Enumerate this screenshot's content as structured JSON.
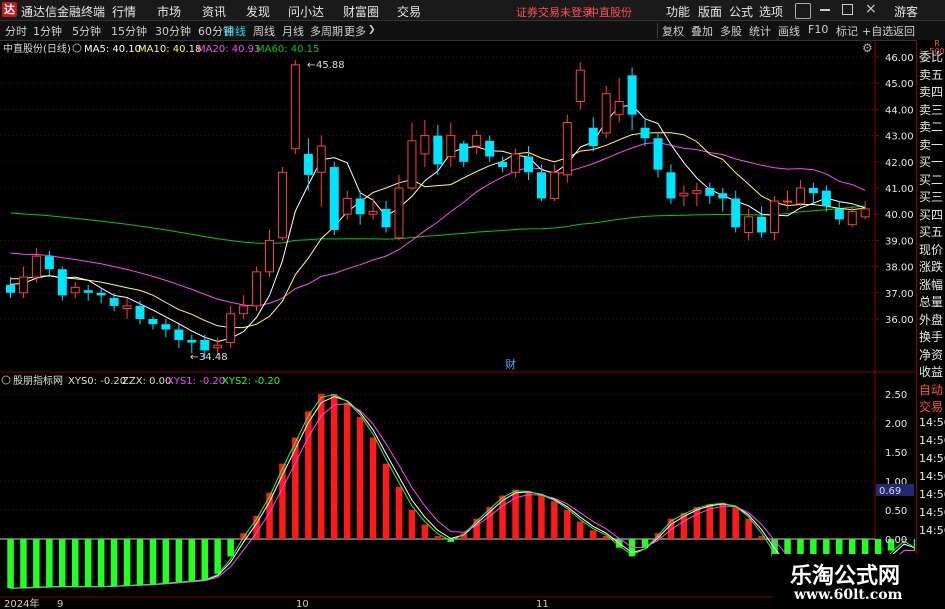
{
  "menu": {
    "app_title": "通达信金融终端",
    "items": [
      "行情",
      "市场",
      "资讯",
      "发现",
      "问小达",
      "财富圈",
      "交易"
    ],
    "status_warning": "证券交易未登录",
    "status_stock": "中直股份",
    "right_items": [
      "功能",
      "版面",
      "公式",
      "选项"
    ],
    "guest": "游客"
  },
  "toolbar": {
    "periods": [
      "分时",
      "1分钟",
      "5分钟",
      "15分钟",
      "30分钟",
      "60分钟",
      "日线",
      "周线",
      "月线",
      "多周期",
      "更多"
    ],
    "selected_period": "日线",
    "right_buttons": [
      "复权",
      "叠加",
      "多股",
      "统计",
      "画线",
      "F10",
      "标记",
      "+自选",
      "返回"
    ]
  },
  "main_legend": {
    "name": "中直股份(日线)",
    "ma5": "MA5: 40.10",
    "ma10": "MA10: 40.18",
    "ma20": "MA20: 40.93",
    "ma60": "MA60: 40.15"
  },
  "annotations": {
    "high_label": "45.88",
    "low_label": "34.48",
    "fin_marker": "财"
  },
  "indicator_legend": {
    "name": "股朋指标网",
    "xys0": "XYS0: -0.20",
    "zzx": "ZZX: 0.00",
    "xys1": "XYS1: -0.20",
    "xys2": "XYS2: -0.20"
  },
  "price_axis": [
    "46.00",
    "45.00",
    "44.00",
    "43.00",
    "42.00",
    "41.00",
    "40.00",
    "39.00",
    "38.00",
    "37.00",
    "36.00"
  ],
  "indicator_axis": [
    "2.50",
    "2.00",
    "1.50",
    "1.00",
    "0.50",
    "0.00"
  ],
  "indicator_current": "0.69",
  "date_axis": [
    "2024年",
    "9",
    "10",
    "11"
  ],
  "right_panel": {
    "top_tag": "R\n500",
    "items": [
      "委比",
      "卖五",
      "卖四",
      "卖三",
      "卖二",
      "卖一",
      "买一",
      "买二",
      "买三",
      "买四",
      "买五",
      "现价",
      "涨跌",
      "涨幅",
      "总量",
      "外盘",
      "换手",
      "净资",
      "收益",
      "自动",
      "交易"
    ],
    "times": [
      "14:56",
      "14:56",
      "14:56",
      "14:56",
      "14:56",
      "14:56",
      "14:56"
    ]
  },
  "watermark": {
    "title": "乐淘公式网",
    "url": "www.60lt.com"
  },
  "colors": {
    "up": "#ff3c3c",
    "down": "#00e5ff",
    "ma5": "#ffffff",
    "ma10": "#ffff66",
    "ma20": "#ff44ff",
    "ma60": "#00cc00",
    "indicator_pos": "#ff1a1a",
    "indicator_neg": "#22ff22",
    "grid": "#8b0000"
  },
  "chart_data": {
    "type": "candlestick",
    "title": "中直股份(日线)",
    "ylim": [
      34.48,
      46.0
    ],
    "candles": [
      {
        "o": 37.3,
        "c": 37.0,
        "h": 37.6,
        "l": 36.8
      },
      {
        "o": 37.0,
        "c": 37.6,
        "h": 38.0,
        "l": 36.8
      },
      {
        "o": 37.6,
        "c": 38.4,
        "h": 38.7,
        "l": 37.4
      },
      {
        "o": 38.4,
        "c": 37.9,
        "h": 38.6,
        "l": 37.6
      },
      {
        "o": 37.9,
        "c": 36.9,
        "h": 38.0,
        "l": 36.7
      },
      {
        "o": 37.0,
        "c": 37.2,
        "h": 37.4,
        "l": 36.8
      },
      {
        "o": 37.1,
        "c": 37.0,
        "h": 37.3,
        "l": 36.7
      },
      {
        "o": 37.0,
        "c": 36.9,
        "h": 37.2,
        "l": 36.6
      },
      {
        "o": 36.8,
        "c": 36.5,
        "h": 37.0,
        "l": 36.3
      },
      {
        "o": 36.4,
        "c": 36.5,
        "h": 36.8,
        "l": 36.0
      },
      {
        "o": 36.5,
        "c": 36.0,
        "h": 36.7,
        "l": 35.8
      },
      {
        "o": 36.0,
        "c": 35.8,
        "h": 36.1,
        "l": 35.6
      },
      {
        "o": 35.8,
        "c": 35.6,
        "h": 36.0,
        "l": 35.3
      },
      {
        "o": 35.6,
        "c": 35.2,
        "h": 35.8,
        "l": 34.9
      },
      {
        "o": 35.2,
        "c": 35.1,
        "h": 35.4,
        "l": 34.7
      },
      {
        "o": 35.2,
        "c": 34.8,
        "h": 35.4,
        "l": 34.48
      },
      {
        "o": 34.9,
        "c": 35.0,
        "h": 35.3,
        "l": 34.6
      },
      {
        "o": 35.1,
        "c": 36.2,
        "h": 36.5,
        "l": 34.9
      },
      {
        "o": 36.2,
        "c": 36.5,
        "h": 36.9,
        "l": 36.0
      },
      {
        "o": 36.5,
        "c": 37.8,
        "h": 38.0,
        "l": 36.3
      },
      {
        "o": 37.8,
        "c": 39.0,
        "h": 39.4,
        "l": 37.6
      },
      {
        "o": 39.1,
        "c": 41.6,
        "h": 41.8,
        "l": 39.0
      },
      {
        "o": 42.5,
        "c": 45.7,
        "h": 45.88,
        "l": 42.3
      },
      {
        "o": 42.3,
        "c": 41.5,
        "h": 42.9,
        "l": 40.9
      },
      {
        "o": 41.6,
        "c": 42.6,
        "h": 43.0,
        "l": 40.3
      },
      {
        "o": 41.8,
        "c": 39.4,
        "h": 42.0,
        "l": 39.2
      },
      {
        "o": 40.0,
        "c": 40.6,
        "h": 40.9,
        "l": 39.8
      },
      {
        "o": 40.6,
        "c": 40.0,
        "h": 40.9,
        "l": 39.6
      },
      {
        "o": 40.0,
        "c": 40.1,
        "h": 40.6,
        "l": 39.8
      },
      {
        "o": 40.2,
        "c": 39.5,
        "h": 40.5,
        "l": 39.3
      },
      {
        "o": 39.1,
        "c": 41.0,
        "h": 41.5,
        "l": 39.0
      },
      {
        "o": 41.0,
        "c": 42.8,
        "h": 43.5,
        "l": 40.9
      },
      {
        "o": 42.3,
        "c": 43.0,
        "h": 43.6,
        "l": 41.8
      },
      {
        "o": 43.0,
        "c": 41.9,
        "h": 43.4,
        "l": 41.5
      },
      {
        "o": 42.2,
        "c": 43.0,
        "h": 43.5,
        "l": 41.8
      },
      {
        "o": 42.7,
        "c": 42.0,
        "h": 42.8,
        "l": 41.8
      },
      {
        "o": 42.6,
        "c": 43.0,
        "h": 43.2,
        "l": 42.3
      },
      {
        "o": 42.8,
        "c": 42.2,
        "h": 43.0,
        "l": 42.0
      },
      {
        "o": 42.0,
        "c": 41.8,
        "h": 42.2,
        "l": 41.6
      },
      {
        "o": 41.6,
        "c": 42.3,
        "h": 42.5,
        "l": 41.4
      },
      {
        "o": 42.2,
        "c": 41.6,
        "h": 42.6,
        "l": 41.3
      },
      {
        "o": 41.6,
        "c": 40.6,
        "h": 41.9,
        "l": 40.5
      },
      {
        "o": 40.6,
        "c": 41.6,
        "h": 41.9,
        "l": 40.5
      },
      {
        "o": 41.5,
        "c": 43.5,
        "h": 43.8,
        "l": 41.2
      },
      {
        "o": 44.3,
        "c": 45.5,
        "h": 45.8,
        "l": 44.0
      },
      {
        "o": 43.3,
        "c": 42.6,
        "h": 43.7,
        "l": 42.4
      },
      {
        "o": 43.1,
        "c": 44.6,
        "h": 44.9,
        "l": 42.9
      },
      {
        "o": 43.8,
        "c": 44.3,
        "h": 45.2,
        "l": 43.5
      },
      {
        "o": 45.3,
        "c": 43.8,
        "h": 45.6,
        "l": 43.2
      },
      {
        "o": 43.3,
        "c": 42.9,
        "h": 43.6,
        "l": 42.6
      },
      {
        "o": 42.9,
        "c": 41.7,
        "h": 43.1,
        "l": 41.4
      },
      {
        "o": 41.6,
        "c": 40.6,
        "h": 41.9,
        "l": 40.4
      },
      {
        "o": 40.7,
        "c": 40.8,
        "h": 41.1,
        "l": 40.3
      },
      {
        "o": 40.8,
        "c": 40.9,
        "h": 41.2,
        "l": 40.3
      },
      {
        "o": 41.0,
        "c": 40.7,
        "h": 41.2,
        "l": 40.4
      },
      {
        "o": 40.8,
        "c": 40.6,
        "h": 41.0,
        "l": 40.1
      },
      {
        "o": 40.6,
        "c": 39.5,
        "h": 40.9,
        "l": 39.3
      },
      {
        "o": 39.3,
        "c": 39.9,
        "h": 40.2,
        "l": 39.0
      },
      {
        "o": 39.9,
        "c": 39.3,
        "h": 40.3,
        "l": 39.1
      },
      {
        "o": 39.3,
        "c": 40.5,
        "h": 40.7,
        "l": 39.0
      },
      {
        "o": 40.5,
        "c": 40.5,
        "h": 40.9,
        "l": 40.2
      },
      {
        "o": 40.4,
        "c": 41.0,
        "h": 41.3,
        "l": 40.3
      },
      {
        "o": 41.0,
        "c": 40.8,
        "h": 41.2,
        "l": 40.4
      },
      {
        "o": 40.9,
        "c": 40.3,
        "h": 41.1,
        "l": 40.1
      },
      {
        "o": 40.2,
        "c": 39.8,
        "h": 40.5,
        "l": 39.6
      },
      {
        "o": 39.6,
        "c": 40.1,
        "h": 40.3,
        "l": 39.5
      },
      {
        "o": 39.9,
        "c": 40.2,
        "h": 40.5,
        "l": 39.8
      }
    ],
    "indicator": [
      -0.85,
      -0.84,
      -0.83,
      -0.82,
      -0.82,
      -0.82,
      -0.82,
      -0.82,
      -0.81,
      -0.8,
      -0.79,
      -0.78,
      -0.76,
      -0.74,
      -0.72,
      -0.7,
      -0.6,
      -0.3,
      0.1,
      0.4,
      0.8,
      1.3,
      1.75,
      2.2,
      2.5,
      2.5,
      2.35,
      2.1,
      1.75,
      1.3,
      0.9,
      0.5,
      0.25,
      0.05,
      -0.05,
      0.1,
      0.35,
      0.55,
      0.75,
      0.85,
      0.82,
      0.75,
      0.65,
      0.5,
      0.3,
      0.15,
      0.05,
      -0.15,
      -0.3,
      -0.15,
      0.1,
      0.35,
      0.45,
      0.55,
      0.6,
      0.62,
      0.55,
      0.35,
      0.05,
      -0.3,
      -0.55,
      -0.75,
      -0.85,
      -0.88,
      -0.9,
      -0.88,
      -0.7,
      -0.4,
      -0.2,
      0.0,
      -0.2
    ]
  }
}
